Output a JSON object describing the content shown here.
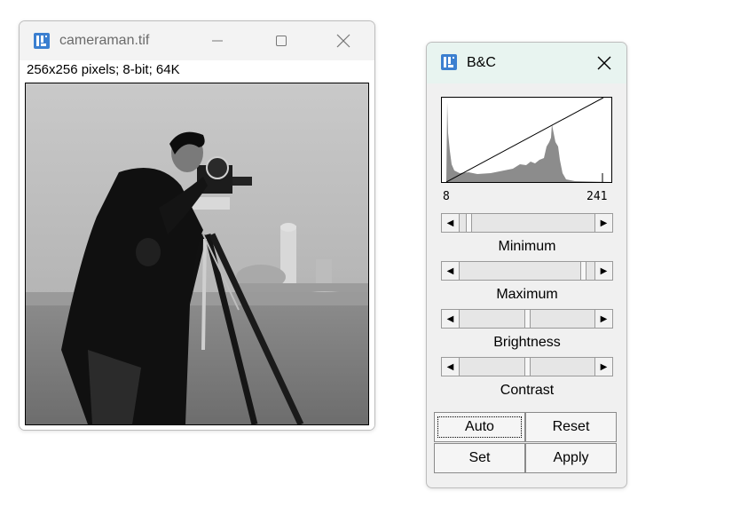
{
  "image_window": {
    "title": "cameraman.tif",
    "info": "256x256 pixels; 8-bit; 64K",
    "icons": {
      "app": "imagej-icon",
      "minimize": "minimize-icon",
      "maximize": "maximize-icon",
      "close": "close-icon"
    }
  },
  "bc_window": {
    "title": "B&C",
    "histogram": {
      "min_label": "8",
      "max_label": "241"
    },
    "sliders": [
      {
        "label": "Minimum",
        "value_fraction": 0.05
      },
      {
        "label": "Maximum",
        "value_fraction": 0.94
      },
      {
        "label": "Brightness",
        "value_fraction": 0.5
      },
      {
        "label": "Contrast",
        "value_fraction": 0.5
      }
    ],
    "buttons": {
      "auto": "Auto",
      "reset": "Reset",
      "set": "Set",
      "apply": "Apply"
    }
  },
  "colors": {
    "titlebar_active": "#e8f4f0",
    "imagej_icon_blue": "#3b7fd0",
    "histogram_fill": "#8c8c8c"
  }
}
